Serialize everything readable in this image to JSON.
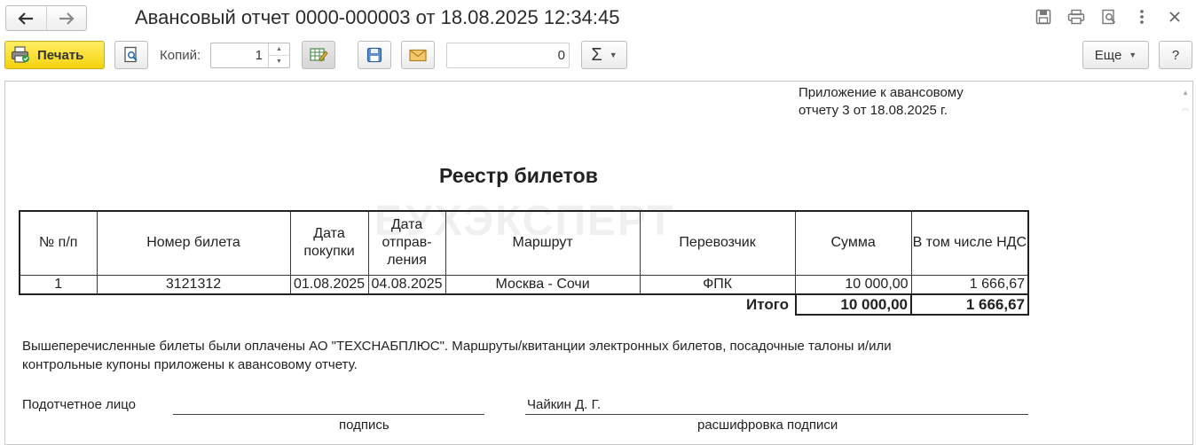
{
  "window": {
    "title": "Авансовый отчет 0000-000003 от 18.08.2025 12:34:45"
  },
  "icons": {
    "back": "arrow-left-icon",
    "forward": "arrow-right-icon",
    "save": "floppy-disk-icon",
    "print": "printer-icon",
    "preview": "print-preview-icon",
    "more": "vertical-dots-icon",
    "close": "close-icon"
  },
  "toolbar": {
    "print_label": "Печать",
    "copies_label": "Копий:",
    "copies_value": "1",
    "number_value": "0",
    "sum_symbol": "Σ",
    "more_label": "Еще",
    "help_label": "?"
  },
  "colors": {
    "print_button": "#f5d20c",
    "border": "#bcbcbc"
  },
  "document": {
    "appendix_line1": "Приложение к авансовому",
    "appendix_line2": "отчету 3 от 18.08.2025 г.",
    "title": "Реестр билетов",
    "watermark": "БУХЭКСПЕРТ",
    "columns": [
      "№ п/п",
      "Номер билета",
      "Дата покупки",
      "Дата отправ- ления",
      "Маршрут",
      "Перевозчик",
      "Сумма",
      "В том числе НДС"
    ],
    "rows": [
      [
        "1",
        "3121312",
        "01.08.2025",
        "04.08.2025",
        "Москва - Сочи",
        "ФПК",
        "10 000,00",
        "1 666,67"
      ]
    ],
    "totals": {
      "label": "Итого",
      "sum": "10 000,00",
      "vat": "1 666,67"
    },
    "note_line1": "Вышеперечисленные билеты были оплачены АО \"ТЕХСНАБПЛЮС\". Маршруты/квитанции электронных билетов, посадочные талоны и/или",
    "note_line2": "контрольные купоны приложены к авансовому отчету.",
    "accountable_label": "Подотчетное лицо",
    "signer_name": "Чайкин Д. Г.",
    "signature_caption": "подпись",
    "decoding_caption": "расшифровка подписи"
  }
}
